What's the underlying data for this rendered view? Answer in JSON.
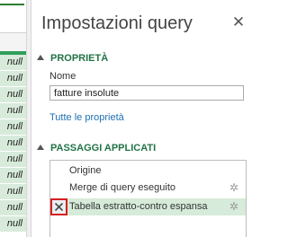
{
  "grid": {
    "filter_icon": "dropdown-arrow-icon",
    "cells": [
      "null",
      "null",
      "null",
      "null",
      "null",
      "null",
      "null",
      "null",
      "null",
      "null",
      "null"
    ]
  },
  "pane": {
    "title": "Impostazioni query",
    "close_icon": "close-icon",
    "properties": {
      "header": "PROPRIETÀ",
      "name_label": "Nome",
      "name_value": "fatture insolute",
      "all_properties_link": "Tutte le proprietà"
    },
    "applied_steps": {
      "header": "PASSAGGI APPLICATI",
      "steps": [
        {
          "label": "Origine",
          "has_gear": false,
          "selected": false
        },
        {
          "label": "Merge di query eseguito",
          "has_gear": true,
          "selected": false
        },
        {
          "label": "Tabella estratto-contro espansa",
          "has_gear": true,
          "selected": true
        }
      ],
      "delete_icon": "delete-x-icon"
    }
  },
  "colors": {
    "accent_green": "#217346",
    "selected_row": "#d6ebd9",
    "grid_cell": "#d8ebdb",
    "link_blue": "#1f6fb2",
    "delete_highlight": "#d61f1f"
  }
}
